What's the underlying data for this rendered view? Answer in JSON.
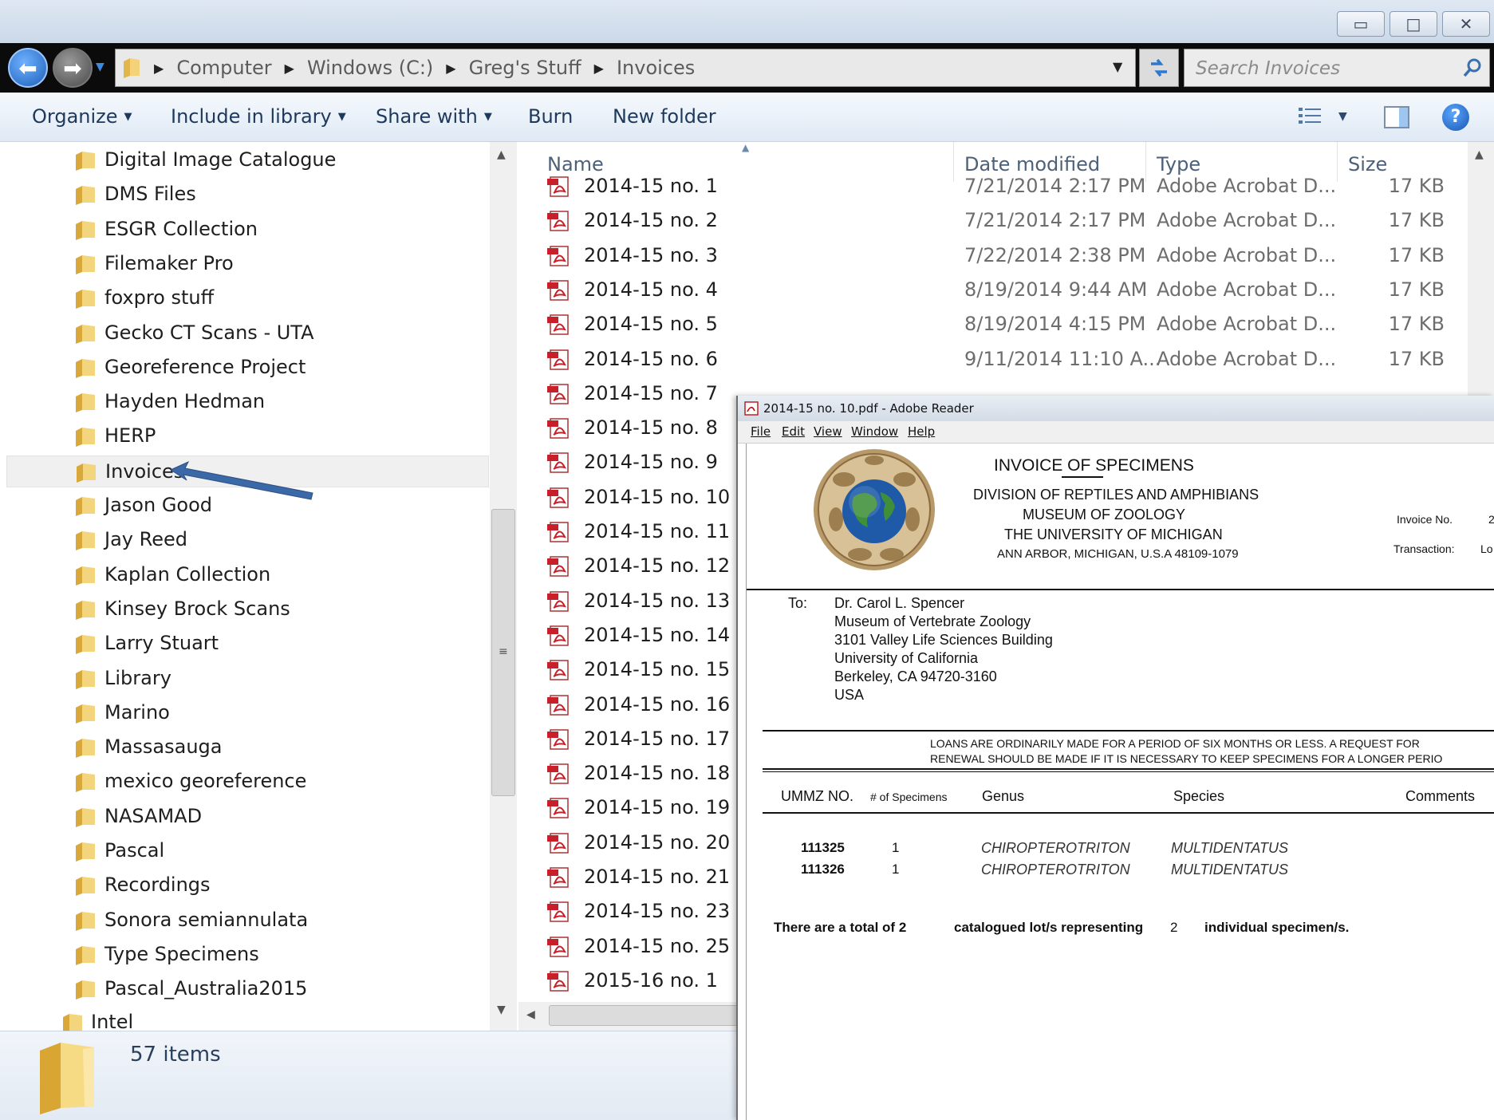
{
  "window": {
    "controls": {
      "minimize": "▭",
      "maximize": "□",
      "close": "✕"
    }
  },
  "address": {
    "crumbs": [
      "Computer",
      "Windows (C:)",
      "Greg's Stuff",
      "Invoices"
    ],
    "search_placeholder": "Search Invoices"
  },
  "toolbar": {
    "organize": "Organize",
    "include_in_library": "Include in library",
    "share_with": "Share with",
    "burn": "Burn",
    "new_folder": "New folder",
    "help": "?"
  },
  "nav": {
    "items": [
      "Digital Image Catalogue",
      "DMS Files",
      "ESGR Collection",
      "Filemaker Pro",
      "foxpro stuff",
      "Gecko CT Scans - UTA",
      "Georeference Project",
      "Hayden Hedman",
      "HERP",
      "Invoices",
      "Jason Good",
      "Jay Reed",
      "Kaplan Collection",
      "Kinsey Brock Scans",
      "Larry Stuart",
      "Library",
      "Marino",
      "Massasauga",
      "mexico georeference",
      "NASAMAD",
      "Pascal",
      "Recordings",
      "Sonora semiannulata",
      "Type Specimens",
      "Pascal_Australia2015"
    ],
    "parent_item": "Intel",
    "selected": "Invoices"
  },
  "files": {
    "columns": {
      "name": "Name",
      "date": "Date modified",
      "type": "Type",
      "size": "Size"
    },
    "rows": [
      {
        "name": "2014-15 no. 1",
        "date": "7/21/2014 2:17 PM",
        "type": "Adobe Acrobat D...",
        "size": "17 KB"
      },
      {
        "name": "2014-15 no. 2",
        "date": "7/21/2014 2:17 PM",
        "type": "Adobe Acrobat D...",
        "size": "17 KB"
      },
      {
        "name": "2014-15 no. 3",
        "date": "7/22/2014 2:38 PM",
        "type": "Adobe Acrobat D...",
        "size": "17 KB"
      },
      {
        "name": "2014-15 no. 4",
        "date": "8/19/2014 9:44 AM",
        "type": "Adobe Acrobat D...",
        "size": "17 KB"
      },
      {
        "name": "2014-15 no. 5",
        "date": "8/19/2014 4:15 PM",
        "type": "Adobe Acrobat D...",
        "size": "17 KB"
      },
      {
        "name": "2014-15 no. 6",
        "date": "9/11/2014 11:10 A...",
        "type": "Adobe Acrobat D...",
        "size": "17 KB"
      },
      {
        "name": "2014-15 no. 7"
      },
      {
        "name": "2014-15 no. 8"
      },
      {
        "name": "2014-15 no. 9"
      },
      {
        "name": "2014-15 no. 10"
      },
      {
        "name": "2014-15 no. 11"
      },
      {
        "name": "2014-15 no. 12"
      },
      {
        "name": "2014-15 no. 13"
      },
      {
        "name": "2014-15 no. 14"
      },
      {
        "name": "2014-15 no. 15"
      },
      {
        "name": "2014-15 no. 16"
      },
      {
        "name": "2014-15 no. 17"
      },
      {
        "name": "2014-15 no. 18"
      },
      {
        "name": "2014-15 no. 19"
      },
      {
        "name": "2014-15 no. 20"
      },
      {
        "name": "2014-15 no. 21"
      },
      {
        "name": "2014-15 no. 23"
      },
      {
        "name": "2014-15 no. 25"
      },
      {
        "name": "2015-16 no. 1"
      }
    ]
  },
  "details": {
    "count": "57 items"
  },
  "reader": {
    "title": "2014-15 no. 10.pdf - Adobe Reader",
    "menu": [
      "File",
      "Edit",
      "View",
      "Window",
      "Help"
    ],
    "doc": {
      "heading": "INVOICE OF SPECIMENS",
      "division": "DIVISION OF REPTILES AND AMPHIBIANS",
      "museum": "MUSEUM OF ZOOLOGY",
      "university": "THE UNIVERSITY OF MICHIGAN",
      "address": "ANN ARBOR, MICHIGAN, U.S.A 48109-1079",
      "invoice_no_label": "Invoice No.",
      "invoice_no_value": "2",
      "transaction_label": "Transaction:",
      "transaction_value": "Lo",
      "to_label": "To:",
      "recipient": [
        "Dr. Carol L. Spencer",
        "Museum of Vertebrate Zoology",
        "3101 Valley Life Sciences Building",
        "University of California",
        "Berkeley, CA 94720-3160",
        "USA"
      ],
      "loan_notice_1": "LOANS ARE ORDINARILY MADE FOR A PERIOD OF SIX MONTHS OR LESS.  A REQUEST FOR",
      "loan_notice_2": "RENEWAL SHOULD BE MADE IF IT IS NECESSARY TO KEEP SPECIMENS FOR A LONGER PERIO",
      "table_headers": {
        "ummz": "UMMZ NO.",
        "count": "# of Specimens",
        "genus": "Genus",
        "species": "Species",
        "comments": "Comments"
      },
      "specimens": [
        {
          "ummz": "111325",
          "count": "1",
          "genus": "CHIROPTEROTRITON",
          "species": "MULTIDENTATUS"
        },
        {
          "ummz": "111326",
          "count": "1",
          "genus": "CHIROPTEROTRITON",
          "species": "MULTIDENTATUS"
        }
      ],
      "total_part1": "There are a total of 2",
      "total_part2": "catalogued lot/s representing",
      "total_part3": "2",
      "total_part4": "individual specimen/s."
    }
  },
  "colors": {
    "toolbar_text": "#1e395b",
    "header_text": "#4c607a",
    "annotation_arrow": "#3b69a8",
    "back_button": "#2f78d0"
  }
}
